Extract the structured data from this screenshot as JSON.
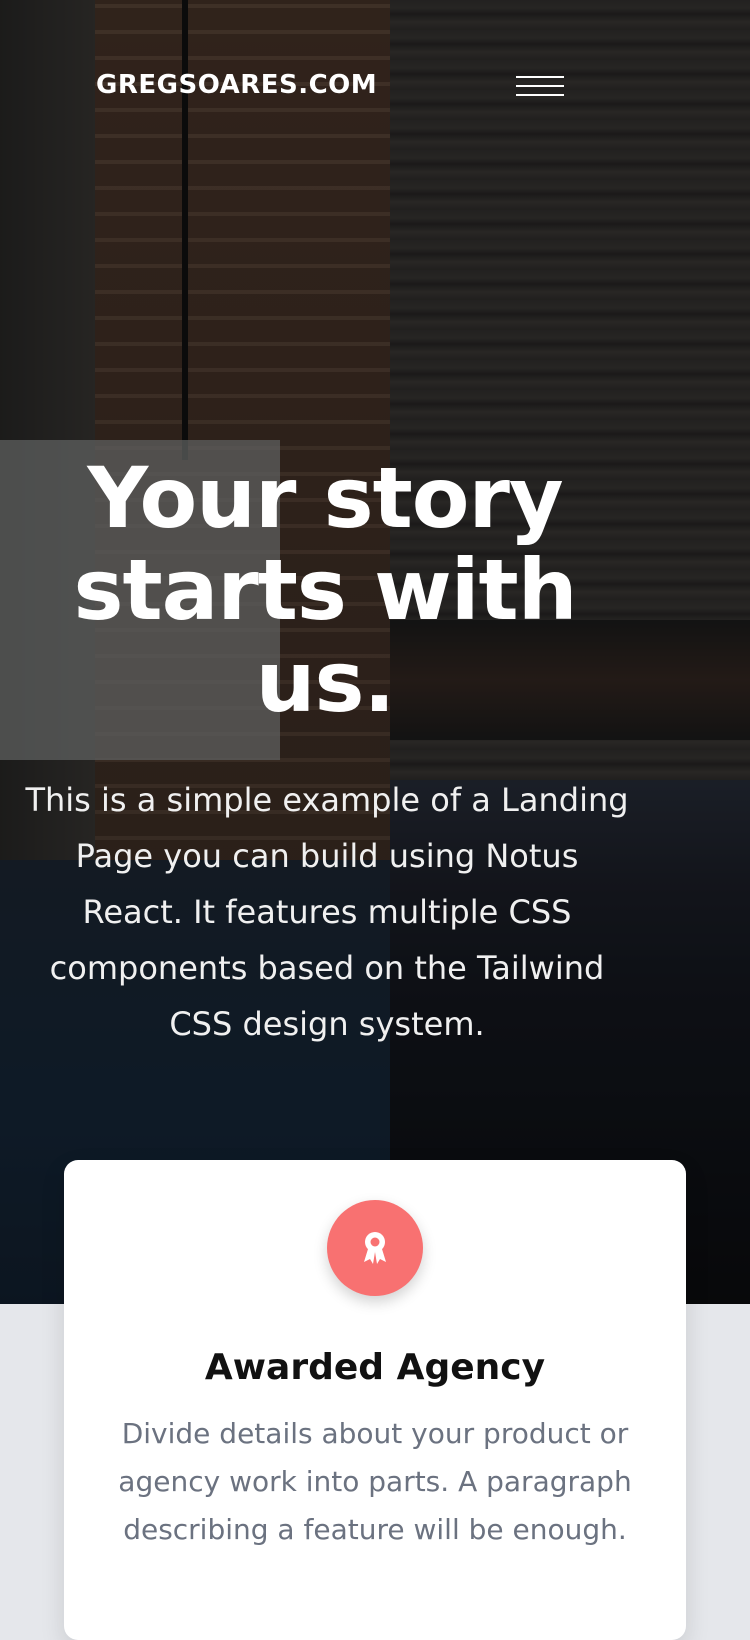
{
  "navbar": {
    "brand": "GREGSOARES.COM",
    "menu_icon": "hamburger-menu-icon"
  },
  "hero": {
    "title": "Your story starts with us.",
    "description": "This is a simple example of a Landing Page you can build using Notus React. It features multiple CSS components based on the Tailwind CSS design system."
  },
  "feature_card": {
    "icon": "award-icon",
    "icon_color": "#f87171",
    "title": "Awarded Agency",
    "description": "Divide details about your product or agency work into parts. A paragraph describing a feature will be enough."
  },
  "colors": {
    "page_background": "#e5e7eb",
    "card_background": "#ffffff",
    "card_text": "#6b7280"
  }
}
